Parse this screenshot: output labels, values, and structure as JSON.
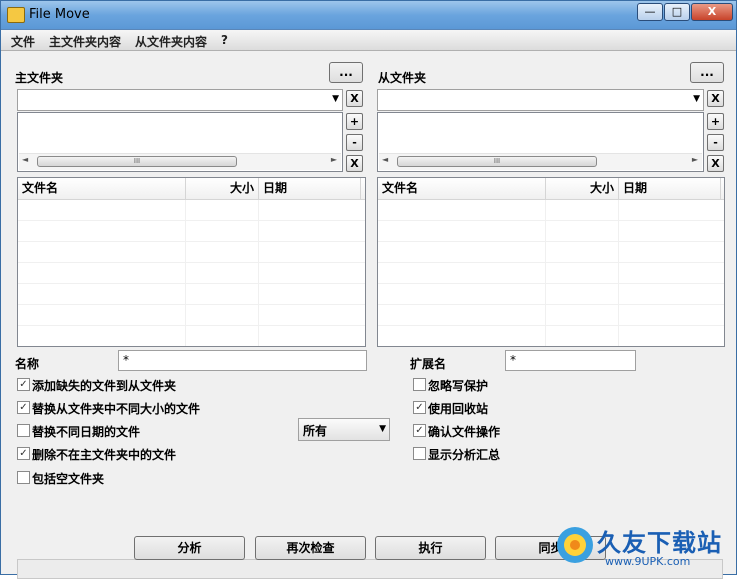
{
  "window": {
    "title": "File Move",
    "min": "—",
    "max": "□",
    "close": "X"
  },
  "menu": [
    "文件",
    "主文件夹内容",
    "从文件夹内容",
    "?"
  ],
  "master": {
    "label": "主文件夹",
    "browse": "...",
    "clear": "X",
    "add": "+",
    "remove": "-",
    "remove_all": "X",
    "columns": [
      "文件名",
      "大小",
      "日期"
    ]
  },
  "slave": {
    "label": "从文件夹",
    "browse": "...",
    "clear": "X",
    "add": "+",
    "remove": "-",
    "remove_all": "X",
    "columns": [
      "文件名",
      "大小",
      "日期"
    ]
  },
  "scroll_grip": "III",
  "filters": {
    "name_label": "名称",
    "name_value": "*",
    "ext_label": "扩展名",
    "ext_value": "*"
  },
  "options_left": [
    {
      "label": "添加缺失的文件到从文件夹",
      "checked": true
    },
    {
      "label": "替换从文件夹中不同大小的文件",
      "checked": true
    },
    {
      "label": "替换不同日期的文件",
      "checked": false
    },
    {
      "label": "删除不在主文件夹中的文件",
      "checked": true
    },
    {
      "label": "包括空文件夹",
      "checked": false
    }
  ],
  "options_right": [
    {
      "label": "忽略写保护",
      "checked": false
    },
    {
      "label": "使用回收站",
      "checked": true
    },
    {
      "label": "确认文件操作",
      "checked": true
    },
    {
      "label": "显示分析汇总",
      "checked": false
    }
  ],
  "date_mode": "所有",
  "check_mark": "✓",
  "buttons": {
    "analyze": "分析",
    "recheck": "再次检查",
    "execute": "执行",
    "sync": "同步"
  },
  "watermark": {
    "brand": "久友下载站",
    "url": "www.9UPK.com"
  }
}
